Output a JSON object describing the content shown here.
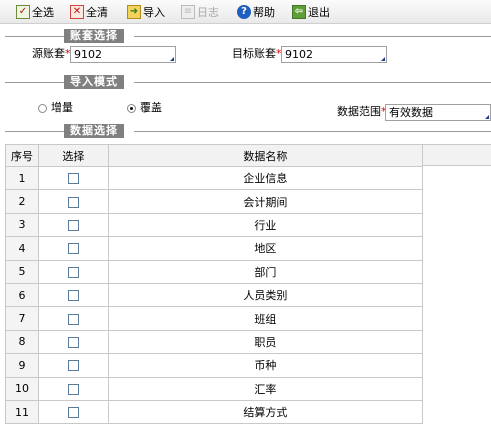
{
  "toolbar": {
    "items": [
      {
        "label": "全选",
        "icon": "select-all-icon"
      },
      {
        "label": "全清",
        "icon": "clear-all-icon"
      },
      {
        "label": "导入",
        "icon": "import-icon"
      },
      {
        "label": "日志",
        "icon": "log-icon",
        "disabled": true
      },
      {
        "label": "帮助",
        "icon": "help-icon"
      },
      {
        "label": "退出",
        "icon": "exit-icon"
      }
    ]
  },
  "account_section": {
    "title": "账套选择",
    "source_label": "源账套",
    "source_value": "9102",
    "target_label": "目标账套",
    "target_value": "9102",
    "required_mark": "*"
  },
  "import_mode": {
    "title": "导入模式",
    "option_incremental": "增量",
    "option_overwrite": "覆盖",
    "selected": "覆盖",
    "range_label": "数据范围",
    "range_value": "有效数据",
    "required_mark": "*"
  },
  "data_section": {
    "title": "数据选择",
    "columns": [
      "序号",
      "选择",
      "数据名称"
    ],
    "rows": [
      {
        "no": "1",
        "name": "企业信息",
        "checked": false
      },
      {
        "no": "2",
        "name": "会计期间",
        "checked": false
      },
      {
        "no": "3",
        "name": "行业",
        "checked": false
      },
      {
        "no": "4",
        "name": "地区",
        "checked": false
      },
      {
        "no": "5",
        "name": "部门",
        "checked": false
      },
      {
        "no": "6",
        "name": "人员类别",
        "checked": false
      },
      {
        "no": "7",
        "name": "班组",
        "checked": false
      },
      {
        "no": "8",
        "name": "职员",
        "checked": false
      },
      {
        "no": "9",
        "name": "币种",
        "checked": false
      },
      {
        "no": "10",
        "name": "汇率",
        "checked": false
      },
      {
        "no": "11",
        "name": "结算方式",
        "checked": false
      }
    ]
  }
}
